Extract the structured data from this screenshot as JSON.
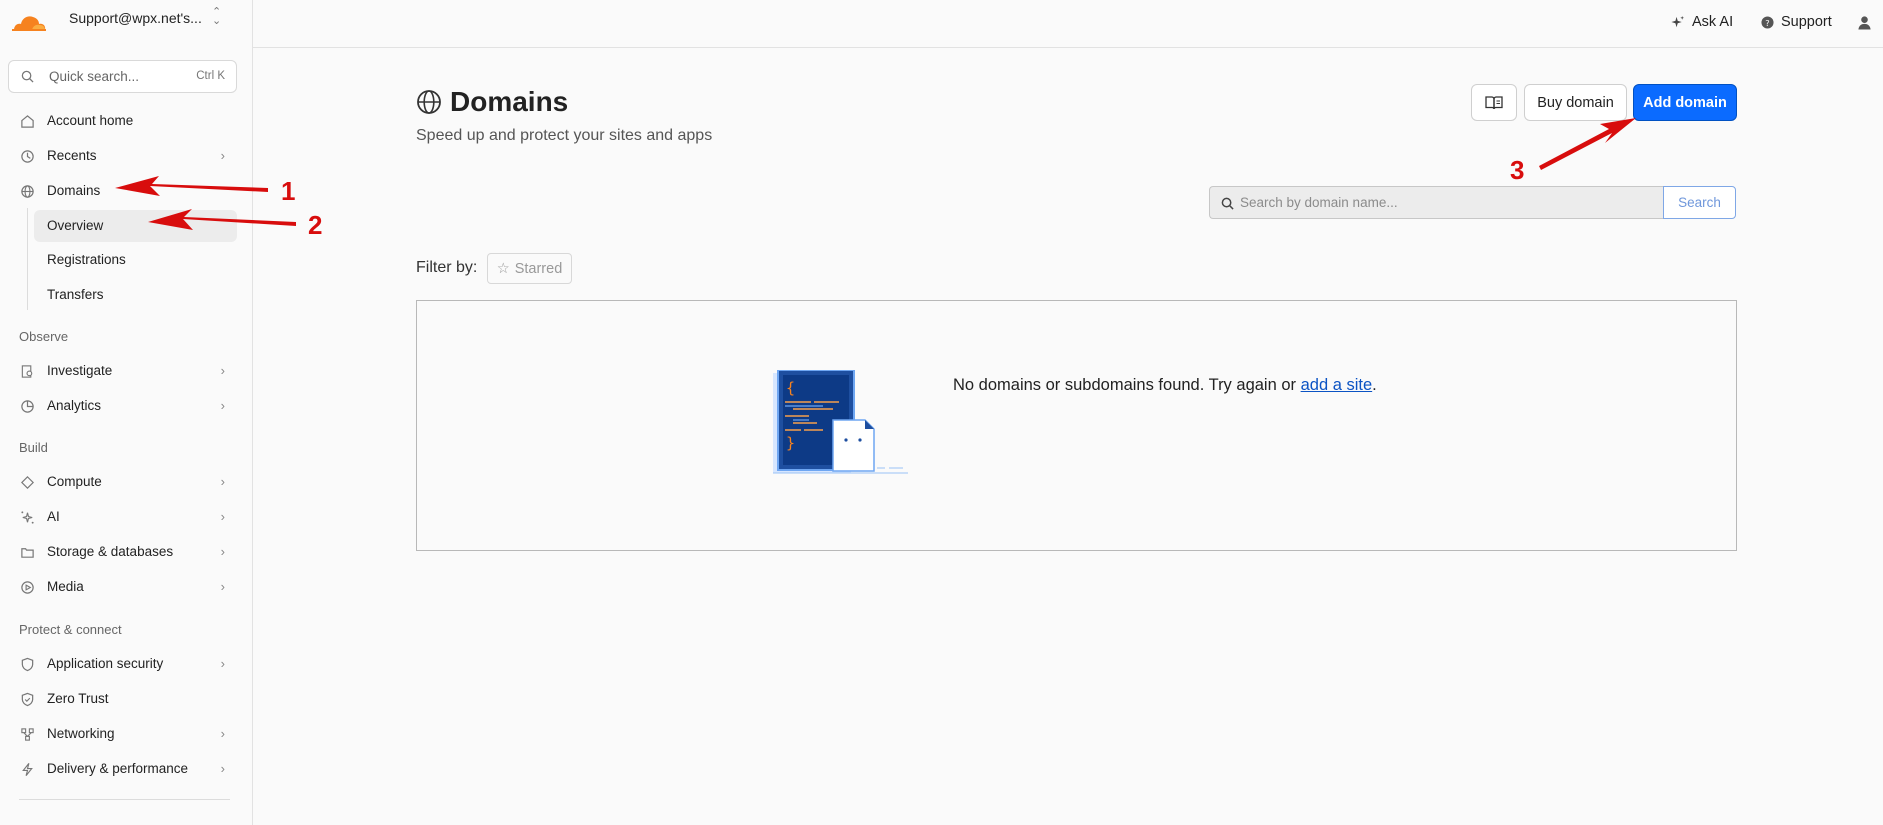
{
  "account": {
    "name": "Support@wpx.net's..."
  },
  "quick_search": {
    "placeholder": "Quick search...",
    "shortcut": "Ctrl K"
  },
  "sidebar": {
    "items": [
      {
        "label": "Account home",
        "icon": "home-icon"
      },
      {
        "label": "Recents",
        "icon": "history-icon"
      },
      {
        "label": "Domains",
        "icon": "globe-icon"
      },
      {
        "label": "Overview"
      },
      {
        "label": "Registrations"
      },
      {
        "label": "Transfers"
      },
      {
        "label": "Investigate",
        "icon": "investigate-icon"
      },
      {
        "label": "Analytics",
        "icon": "analytics-icon"
      },
      {
        "label": "Compute",
        "icon": "compute-icon"
      },
      {
        "label": "AI",
        "icon": "ai-sparkle-icon"
      },
      {
        "label": "Storage & databases",
        "icon": "storage-icon"
      },
      {
        "label": "Media",
        "icon": "media-icon"
      },
      {
        "label": "Application security",
        "icon": "shield-icon"
      },
      {
        "label": "Zero Trust",
        "icon": "zero-trust-icon"
      },
      {
        "label": "Networking",
        "icon": "network-icon"
      },
      {
        "label": "Delivery & performance",
        "icon": "bolt-icon"
      }
    ],
    "sections": {
      "observe": "Observe",
      "build": "Build",
      "protect": "Protect & connect"
    }
  },
  "topbar": {
    "ask_ai": "Ask AI",
    "support": "Support"
  },
  "page": {
    "title": "Domains",
    "subtitle": "Speed up and protect your sites and apps",
    "buy_domain": "Buy domain",
    "add_domain": "Add domain"
  },
  "domain_search": {
    "placeholder": "Search by domain name...",
    "button": "Search"
  },
  "filter": {
    "label": "Filter by:",
    "starred": "Starred"
  },
  "empty_state": {
    "message": "No domains or subdomains found. Try again or ",
    "link": "add a site",
    "suffix": "."
  },
  "annotations": {
    "n1": "1",
    "n2": "2",
    "n3": "3"
  },
  "colors": {
    "accent": "#0b6bff",
    "annotation": "#d80d0d",
    "brand_orange": "#f6821f"
  }
}
